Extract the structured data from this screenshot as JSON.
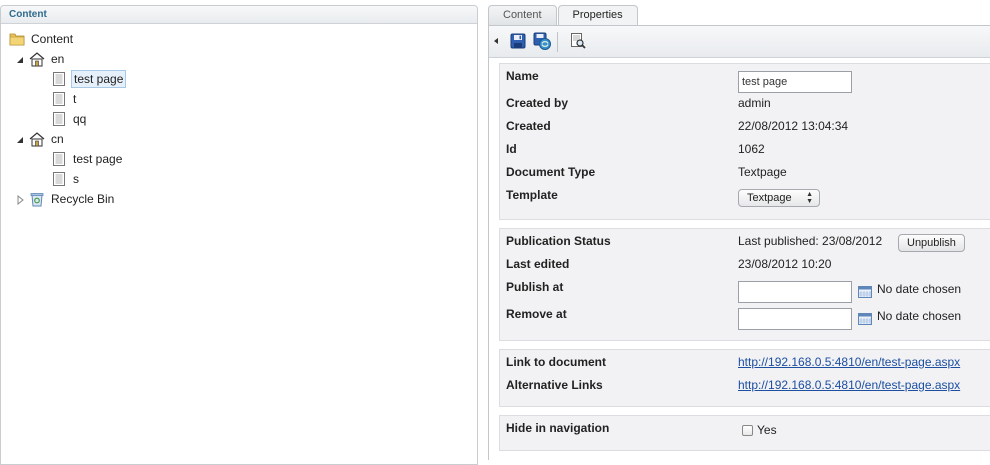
{
  "tree": {
    "header": "Content",
    "root_label": "Content",
    "nodes": [
      {
        "label": "en"
      },
      {
        "label": "test page"
      },
      {
        "label": "t"
      },
      {
        "label": "qq"
      },
      {
        "label": "cn"
      },
      {
        "label": "test page"
      },
      {
        "label": "s"
      },
      {
        "label": "Recycle Bin"
      }
    ]
  },
  "tabs": [
    "Content",
    "Properties"
  ],
  "toolbar": {
    "icons": [
      "collapse-arrow-icon",
      "save-icon",
      "save-and-publish-icon",
      "preview-icon"
    ]
  },
  "properties": {
    "name_label": "Name",
    "name_value": "test page",
    "created_by_label": "Created by",
    "created_by_value": "admin",
    "created_label": "Created",
    "created_value": "22/08/2012 13:04:34",
    "id_label": "Id",
    "id_value": "1062",
    "doctype_label": "Document Type",
    "doctype_value": "Textpage",
    "template_label": "Template",
    "template_value": "Textpage"
  },
  "publication": {
    "status_label": "Publication Status",
    "status_value": "Last published: 23/08/2012",
    "unpublish_label": "Unpublish",
    "last_edited_label": "Last edited",
    "last_edited_value": "23/08/2012 10:20",
    "publish_at_label": "Publish at",
    "publish_at_note": "No date chosen",
    "remove_at_label": "Remove at",
    "remove_at_note": "No date chosen"
  },
  "links": {
    "link_label": "Link to document",
    "link_value": "http://192.168.0.5:4810/en/test-page.aspx",
    "alt_label": "Alternative Links",
    "alt_value": "http://192.168.0.5:4810/en/test-page.aspx"
  },
  "navigation": {
    "hide_label": "Hide in navigation",
    "yes_label": "Yes"
  }
}
